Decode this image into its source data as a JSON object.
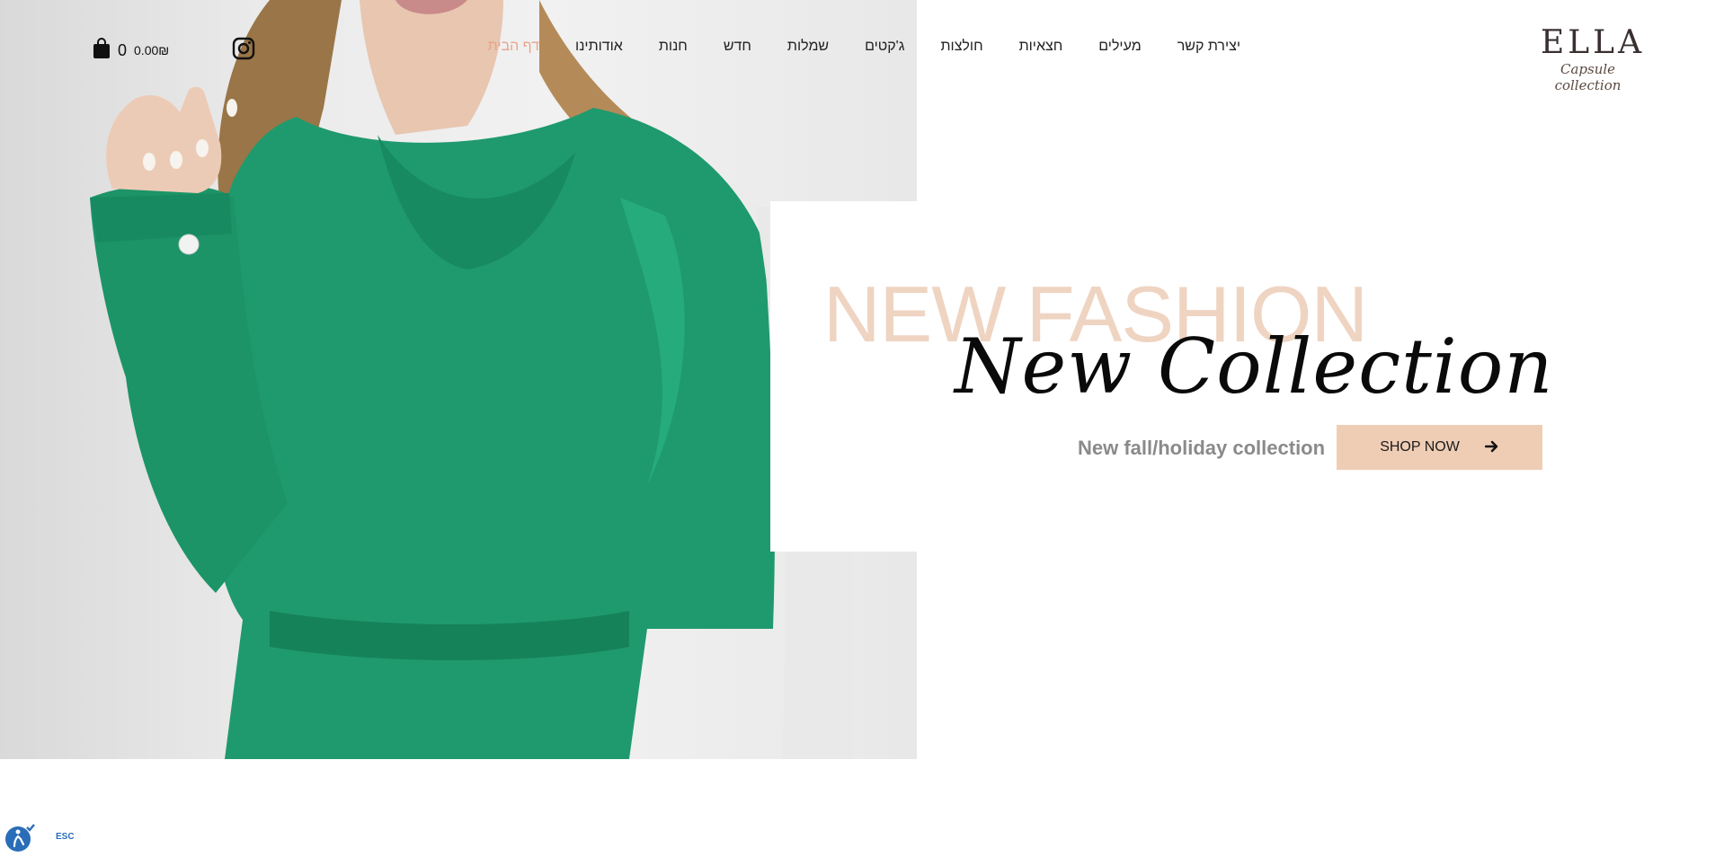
{
  "brand": {
    "logo_main": "ELLA",
    "logo_sub": "Capsule collection"
  },
  "nav": {
    "items": [
      {
        "label": "דף הבית",
        "active": true
      },
      {
        "label": "אודותינו",
        "active": false
      },
      {
        "label": "חנות",
        "active": false
      },
      {
        "label": "חדש",
        "active": false
      },
      {
        "label": "שמלות",
        "active": false
      },
      {
        "label": "ג'קטים",
        "active": false
      },
      {
        "label": "חולצות",
        "active": false
      },
      {
        "label": "חצאיות",
        "active": false
      },
      {
        "label": "מעילים",
        "active": false
      },
      {
        "label": "יצירת קשר",
        "active": false
      }
    ]
  },
  "cart": {
    "count": "0",
    "total": "0.00₪"
  },
  "hero": {
    "eyebrow": "NEW FASHION",
    "headline": "New Collection",
    "tagline": "New fall/holiday collection",
    "cta_label": "SHOP NOW"
  },
  "accessibility": {
    "esc_label": "ESC"
  },
  "colors": {
    "accent": "#e8a58a",
    "cta_bg": "#efcdb5",
    "eyebrow": "#efd4c2",
    "garment": "#1f9a6e"
  },
  "icons": {
    "instagram": "instagram-icon",
    "cart": "shopping-bag-icon",
    "arrow": "arrow-right-icon",
    "accessibility": "accessibility-icon"
  }
}
